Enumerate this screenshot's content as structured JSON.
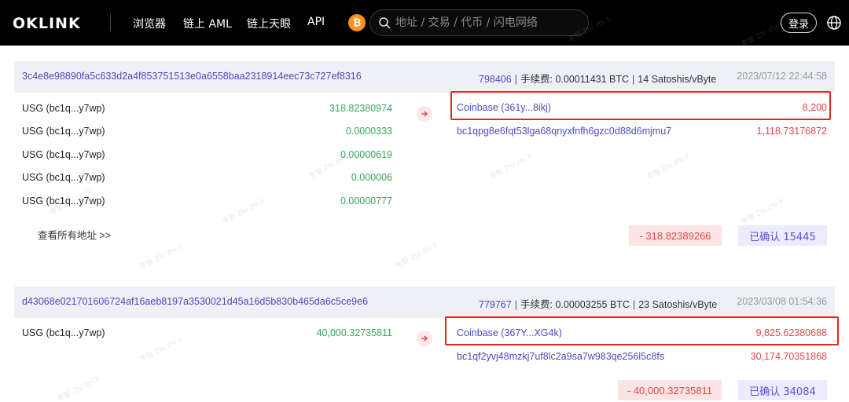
{
  "nav": {
    "logo_text": "OKLINK",
    "links": [
      "浏览器",
      "链上 AML",
      "链上天眼",
      "API"
    ],
    "coin_symbol": "₿",
    "search_placeholder": "地址 / 交易 / 代币 / 闪电网络",
    "login_label": "登录"
  },
  "colors": {
    "accent": "#4b4bbf",
    "positive": "#3aa65a",
    "negative": "#e04848",
    "highlight": "#e3261f",
    "btc": "#f7931a"
  },
  "transactions": [
    {
      "hash": "3c4e8e98890fa5c633d2a4f853751513e0a6558baa2318914eec73c727ef8316",
      "block": "798406",
      "fee_label": "手续费:",
      "fee": "0.00011431 BTC",
      "rate": "14 Satoshis/vByte",
      "time": "2023/07/12 22:44:58",
      "inputs": [
        {
          "label": "USG (bc1q...y7wp)",
          "value": "318.82380974"
        },
        {
          "label": "USG (bc1q...y7wp)",
          "value": "0.0000333"
        },
        {
          "label": "USG (bc1q...y7wp)",
          "value": "0.00000619"
        },
        {
          "label": "USG (bc1q...y7wp)",
          "value": "0.000006"
        },
        {
          "label": "USG (bc1q...y7wp)",
          "value": "0.00000777"
        }
      ],
      "view_all": "查看所有地址 >>",
      "outputs": [
        {
          "addr": "Coinbase (361y...8ikj)",
          "value": "8,200"
        },
        {
          "addr": "bc1qpg8e6fqt53lga68qnyxfnfh6gzc0d88d6mjmu7",
          "value": "1,118.73176872"
        }
      ],
      "net_change": "- 318.82389266",
      "confirmations": "已确认 15445"
    },
    {
      "hash": "d43068e021701606724af16aeb8197a3530021d45a16d5b830b465da6c5ce9e6",
      "block": "779767",
      "fee_label": "手续费:",
      "fee": "0.00003255 BTC",
      "rate": "23 Satoshis/vByte",
      "time": "2023/03/08 01:54:36",
      "inputs": [
        {
          "label": "USG (bc1q...y7wp)",
          "value": "40,000.32735811"
        }
      ],
      "outputs": [
        {
          "addr": "Coinbase (367Y...XG4k)",
          "value": "9,825.62380688"
        },
        {
          "addr": "bc1qf2yvj48mzkj7uf8lc2a9sa7w983qe256l5c8fs",
          "value": "30,174.70351868"
        }
      ],
      "net_change": "- 40,000.32735811",
      "confirmations": "已确认 34084"
    }
  ],
  "watermark": "李智 Zhi zhi.li"
}
